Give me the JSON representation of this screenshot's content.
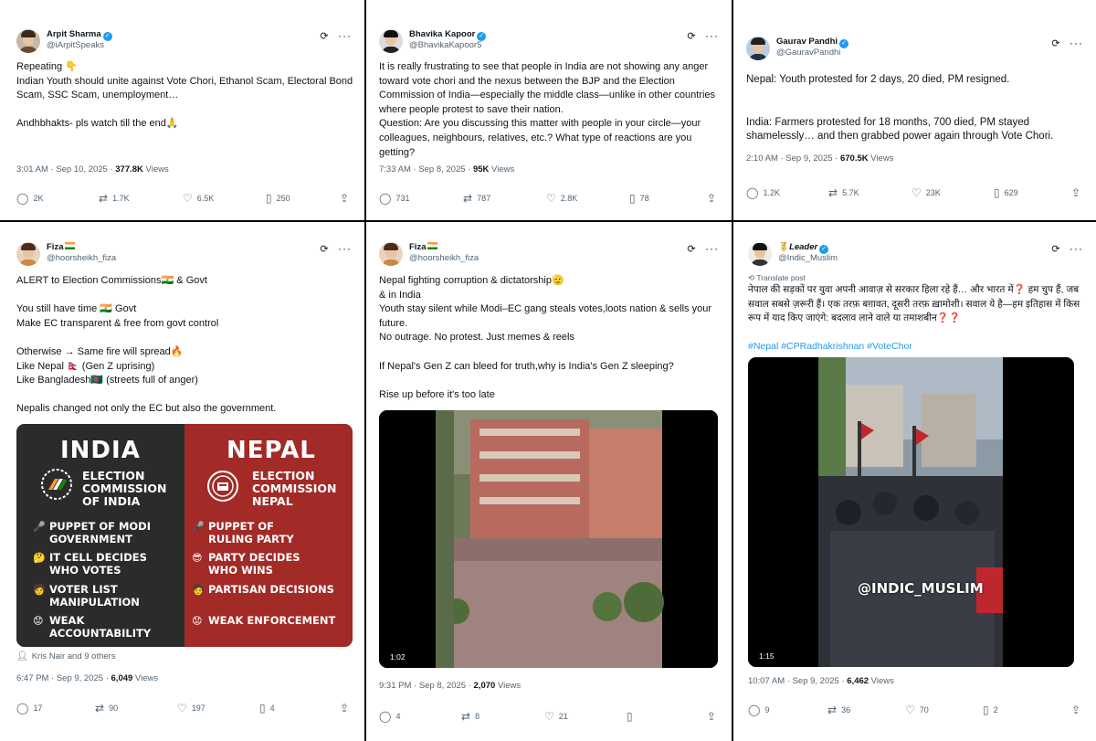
{
  "posts": [
    {
      "name": "Arpit Sharma",
      "handle": "@iArpitSpeaks",
      "text": [
        "Repeating 👇",
        "Indian Youth should unite against Vote Chori, Ethanol Scam, Electoral Bond Scam, SSC Scam, unemployment…",
        "",
        "Andhbhakts- pls watch till the end🙏"
      ],
      "time": "3:01 AM · Sep 10, 2025 · ",
      "views_count": "377.8K",
      "views_label": " Views",
      "replies": "2K",
      "reposts": "1.7K",
      "likes": "6.5K",
      "bookmarks": "250"
    },
    {
      "name": "Bhavika Kapoor",
      "handle": "@BhavikaKapoor5",
      "text": [
        "It is really frustrating to see that people in India are not showing any anger toward vote chori and the nexus between the BJP and the Election Commission of India—especially the middle class—unlike in other countries where people protest to save their nation.",
        "Question: Are you discussing this matter with people in your circle—your colleagues, neighbours, relatives, etc.? What type of reactions are you getting?"
      ],
      "time": "7:33 AM · Sep 8, 2025 · ",
      "views_count": "95K",
      "views_label": " Views",
      "replies": "731",
      "reposts": "787",
      "likes": "2.8K",
      "bookmarks": "78"
    },
    {
      "name": "Gaurav Pandhi",
      "handle": "@GauravPandhi",
      "text": [
        "Nepal: Youth protested for 2 days, 20 died, PM resigned.",
        "",
        "",
        "India: Farmers protested for 18 months, 700 died, PM stayed shamelessly… and then grabbed power again through Vote Chori."
      ],
      "time": "2:10 AM · Sep 9, 2025 · ",
      "views_count": "670.5K",
      "views_label": " Views",
      "replies": "1.2K",
      "reposts": "5.7K",
      "likes": "23K",
      "bookmarks": "629"
    },
    {
      "name": "Fiza",
      "handle": "@hoorsheikh_fiza",
      "text": [
        "ALERT to Election Commissions🇮🇳 & Govt",
        "",
        "You still have time 🇮🇳 Govt",
        "Make EC transparent & free from govt control",
        "",
        "Otherwise → Same fire will spread🔥",
        "Like Nepal 🇳🇵 (Gen Z uprising)",
        "Like Bangladesh🇧🇩 (streets full of anger)",
        "",
        "Nepalis changed not only the EC but also the government."
      ],
      "image": {
        "left_title": "INDIA",
        "left_ec": [
          "ELECTION",
          "COMMISSION",
          "OF INDIA"
        ],
        "left_items": [
          {
            "emoji": "🎤",
            "lines": [
              "PUPPET OF MODI",
              "GOVERNMENT"
            ]
          },
          {
            "emoji": "🤔",
            "lines": [
              "IT CELL DECIDES",
              "WHO VOTES"
            ]
          },
          {
            "emoji": "🧑",
            "lines": [
              "VOTER LIST",
              "MANIPULATION"
            ]
          },
          {
            "emoji": "😟",
            "lines": [
              "WEAK",
              "ACCOUNTABILITY"
            ]
          }
        ],
        "right_title": "NEPAL",
        "right_ec": [
          "ELECTION",
          "COMMISSION",
          "NEPAL"
        ],
        "right_items": [
          {
            "emoji": "🎤",
            "lines": [
              "PUPPET OF",
              "RULING PARTY"
            ]
          },
          {
            "emoji": "😎",
            "lines": [
              "PARTY DECIDES",
              "WHO WINS"
            ]
          },
          {
            "emoji": "🧑",
            "lines": [
              "PARTISAN DECISIONS"
            ]
          },
          {
            "emoji": "😟",
            "lines": [
              "WEAK ENFORCEMENT"
            ]
          }
        ]
      },
      "liked_by": "Kris Nair and 9 others",
      "time": "6:47 PM · Sep 9, 2025 · ",
      "views_count": "6,049",
      "views_label": " Views",
      "replies": "17",
      "reposts": "90",
      "likes": "197",
      "bookmarks": "4"
    },
    {
      "name": "Fiza",
      "handle": "@hoorsheikh_fiza",
      "text": [
        "Nepal fighting corruption & dictatorship🫡",
        "& in India",
        "Youth stay silent while Modi–EC gang steals votes,loots nation & sells your future.",
        "No outrage. No protest. Just memes & reels",
        "",
        "If Nepal's Gen Z can bleed for truth,why is India's Gen Z sleeping?",
        "",
        "Rise up before it's too late"
      ],
      "video_duration": "1:02",
      "time": "9:31 PM · Sep 8, 2025 · ",
      "views_count": "2,070",
      "views_label": " Views",
      "replies": "4",
      "reposts": "8",
      "likes": "21",
      "bookmarks": ""
    },
    {
      "name": "Leader",
      "handle": "@Indic_Muslim",
      "translate": "Translate post",
      "text": [
        "नेपाल की सड़कों पर युवा अपनी आवाज़ से सरकार हिला रहे हैं… और भारत में❓ हम चुप हैं, जब सवाल सबसे ज़रूरी हैं। एक तरफ़ बग़ावत, दूसरी तरफ़ ख़ामोशी। सवाल ये है—हम इतिहास में किस रूप में याद किए जाएंगे: बदलाव लाने वाले या तमाशबीन❓❓",
        "",
        "#Nepal #CPRadhakrishnan #VoteChor"
      ],
      "watermark": "@INDIC_MUSLIM",
      "video_duration": "1:15",
      "time": "10:07 AM · Sep 9, 2025 · ",
      "views_count": "6,462",
      "views_label": " Views",
      "replies": "9",
      "reposts": "36",
      "likes": "70",
      "bookmarks": "2"
    }
  ],
  "icons": {
    "reply": "💬︎",
    "repost": "⇄",
    "like": "♡",
    "bookmark": "⌑",
    "share": "⇪",
    "grok": "⟳",
    "more": "···",
    "verified": "✓"
  }
}
